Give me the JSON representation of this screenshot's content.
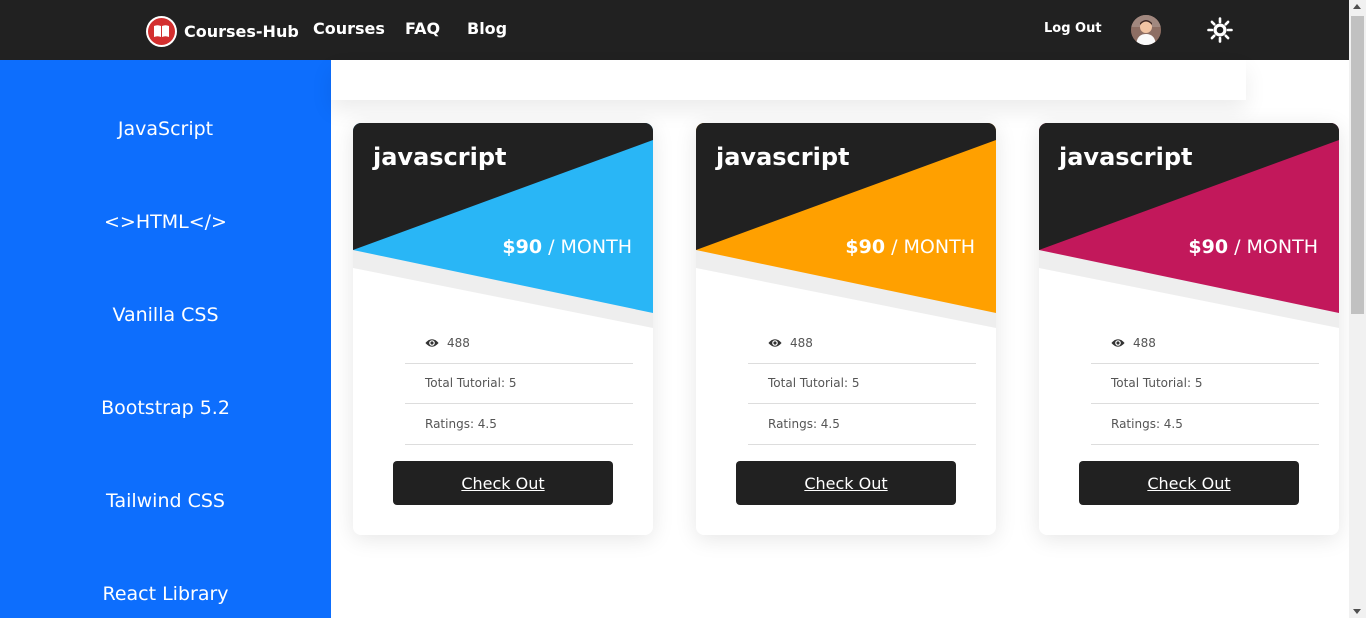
{
  "navbar": {
    "brand": "Courses-Hub",
    "brand_icon": "open-book-icon",
    "links": [
      "Courses",
      "FAQ",
      "Blog"
    ],
    "logout": "Log Out",
    "theme_icon": "sun-icon"
  },
  "sidebar": {
    "items": [
      "JavaScript",
      "<>HTML</>",
      "Vanilla CSS",
      "Bootstrap 5.2",
      "Tailwind CSS",
      "React Library"
    ]
  },
  "cards": [
    {
      "title": "javascript",
      "price": "$90",
      "period": "/ MONTH",
      "views": "488",
      "tutorial": "Total Tutorial: 5",
      "rating": "Ratings: 4.5",
      "button": "Check Out",
      "accent": "#29b6f6"
    },
    {
      "title": "javascript",
      "price": "$90",
      "period": "/ MONTH",
      "views": "488",
      "tutorial": "Total Tutorial: 5",
      "rating": "Ratings: 4.5",
      "button": "Check Out",
      "accent": "#ffa000"
    },
    {
      "title": "javascript",
      "price": "$90",
      "period": "/ MONTH",
      "views": "488",
      "tutorial": "Total Tutorial: 5",
      "rating": "Ratings: 4.5",
      "button": "Check Out",
      "accent": "#c2185b"
    }
  ],
  "colors": {
    "navbar_bg": "#212121",
    "sidebar_bg": "#0d6efd",
    "button_bg": "#212121"
  }
}
